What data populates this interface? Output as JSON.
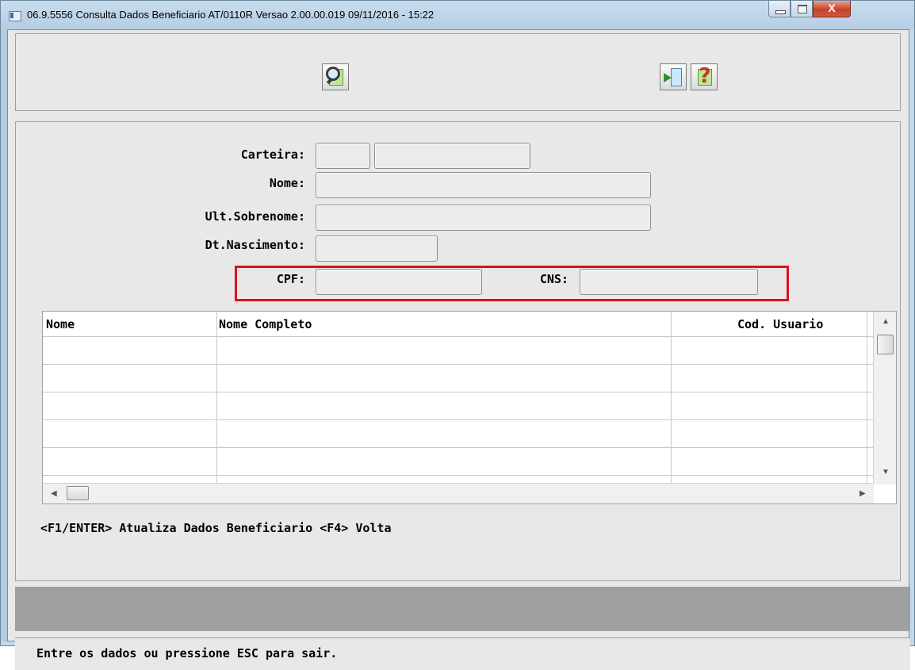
{
  "window": {
    "title": "06.9.5556  Consulta Dados Beneficiario AT/0110R Versao 2.00.00.019 09/11/2016 - 15:22",
    "close_glyph": "X",
    "icons": [
      "app-icon",
      "minimize-icon",
      "maximize-icon",
      "close-icon"
    ]
  },
  "toolbar": {
    "buttons": [
      {
        "name": "search-button",
        "icon": "magnifier-icon"
      },
      {
        "name": "exit-button",
        "icon": "exit-door-icon"
      },
      {
        "name": "help-button",
        "icon": "question-mark-icon",
        "glyph": "?"
      }
    ]
  },
  "form": {
    "carteira_label": "Carteira:",
    "nome_label": "Nome:",
    "sobrenome_label": "Ult.Sobrenome:",
    "nascimento_label": "Dt.Nascimento:",
    "cpf_label": "CPF:",
    "cns_label": "CNS:",
    "values": {
      "carteira_part1": "",
      "carteira_part2": "",
      "nome": "",
      "sobrenome": "",
      "nascimento": "",
      "cpf": "",
      "cns": ""
    },
    "highlight_color": "#e0101a"
  },
  "grid": {
    "columns": [
      "Nome",
      "Nome Completo",
      "Cod. Usuario"
    ],
    "rows": [
      [
        "",
        "",
        ""
      ],
      [
        "",
        "",
        ""
      ],
      [
        "",
        "",
        ""
      ],
      [
        "",
        "",
        ""
      ],
      [
        "",
        "",
        ""
      ]
    ]
  },
  "hint": "<F1/ENTER> Atualiza Dados Beneficiario  <F4> Volta",
  "status": "Entre os dados ou pressione ESC para sair."
}
